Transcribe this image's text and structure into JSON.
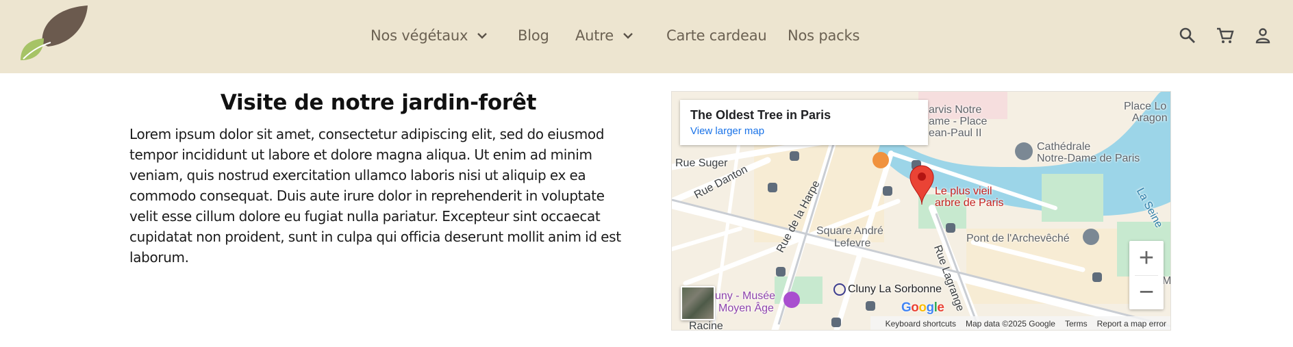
{
  "header": {
    "logo_icon": "leaf-logo",
    "nav": [
      {
        "label": "Nos végétaux",
        "has_dropdown": true
      },
      {
        "label": "Blog",
        "has_dropdown": false
      },
      {
        "label": "Autre",
        "has_dropdown": true
      },
      {
        "label": "Carte cardeau",
        "has_dropdown": false
      },
      {
        "label": "Nos packs",
        "has_dropdown": false
      }
    ],
    "icons": [
      "search-icon",
      "cart-icon",
      "account-icon"
    ],
    "background": "#ede5d0"
  },
  "main": {
    "title": "Visite de notre jardin-forêt",
    "body": "Lorem ipsum dolor sit amet, consectetur adipiscing elit, sed do eiusmod tempor incididunt ut labore et dolore magna aliqua. Ut enim ad minim veniam, quis nostrud exercitation ullamco laboris nisi ut aliquip ex ea commodo consequat. Duis aute irure dolor in reprehenderit in voluptate velit esse cillum dolore eu fugiat nulla pariatur. Excepteur sint occaecat cupidatat non proident, sunt in culpa qui officia deserunt mollit anim id est laborum."
  },
  "map": {
    "card_title": "The Oldest Tree in Paris",
    "card_link": "View larger map",
    "marker_label_1": "Le plus vieil",
    "marker_label_2": "arbre de Paris",
    "labels": {
      "rue_suger": "Rue Suger",
      "rue_danton": "Rue Danton",
      "rue_harpe": "Rue de la Harpe",
      "square_1": "Square André",
      "square_2": "Lefevre",
      "rue_lagrange": "Rue Lagrange",
      "cluny_sorbonne": "Cluny La Sorbonne",
      "musee_1": "uny - Musée",
      "musee_2": "Moyen Âge",
      "pont": "Pont de l'Archevêché",
      "cathedrale_1": "Cathédrale",
      "cathedrale_2": "Notre-Dame de Paris",
      "seine": "La Seine",
      "jarvis_1": "arvis Notre",
      "jarvis_2": "ame - Place",
      "jarvis_3": "ean-Paul II",
      "place_1": "Place Lo",
      "place_2": "Aragon",
      "racine": "Racine",
      "edge_m": "M"
    },
    "zoom_in": "+",
    "zoom_out": "−",
    "google": [
      "G",
      "o",
      "o",
      "g",
      "l",
      "e"
    ],
    "google_colors": [
      "#4285F4",
      "#EA4335",
      "#FBBC05",
      "#4285F4",
      "#34A853",
      "#EA4335"
    ],
    "footer": {
      "shortcuts": "Keyboard shortcuts",
      "data": "Map data ©2025 Google",
      "terms": "Terms",
      "report": "Report a map error"
    },
    "colors": {
      "water": "#9cd5e8",
      "park": "#c7e9cf",
      "marker": "#ea4335",
      "marker_label": "#c5221f"
    }
  }
}
